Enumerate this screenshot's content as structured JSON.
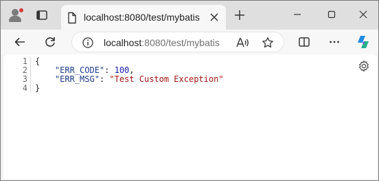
{
  "tab": {
    "title": "localhost:8080/test/mybatis"
  },
  "address_bar": {
    "host": "localhost",
    "path": ":8080/test/mybatis"
  },
  "json_view": {
    "line_numbers": [
      "1",
      "2",
      "3",
      "4"
    ],
    "open_brace": "{",
    "close_brace": "}",
    "err_code_key": "\"ERR_CODE\"",
    "err_code_value": "100",
    "err_msg_key": "\"ERR_MSG\"",
    "err_msg_value": "\"Test Custom Exception\"",
    "colon": ": ",
    "comma": ","
  },
  "colors": {
    "tab_strip": "#dfdfdf",
    "toolbar": "#f7f7f7",
    "json_key": "#1b3a8a",
    "json_string": "#a31515",
    "json_number": "#1a1aa6",
    "profile_badge": "#d73a3a"
  }
}
